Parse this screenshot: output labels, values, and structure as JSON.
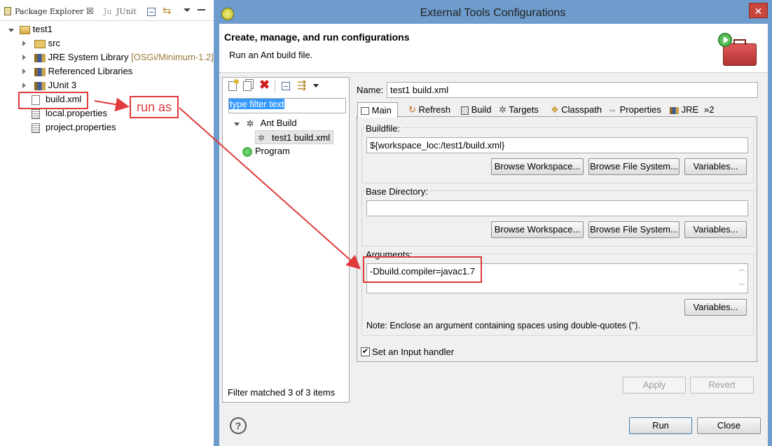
{
  "explorer": {
    "tab_label": "Package Explorer",
    "tab_close": "☒",
    "junit_tab_label": "JUnit",
    "tree": {
      "project": "test1",
      "src": "src",
      "jre": "JRE System Library",
      "jre_decor": "[OSGi/Minimum-1.2]",
      "ref_libs": "Referenced Libraries",
      "junit": "JUnit 3",
      "build_xml": "build.xml",
      "local_props": "local.properties",
      "project_props": "project.properties"
    },
    "callout": "run as"
  },
  "dialog": {
    "title": "External Tools Configurations",
    "close_glyph": "✕",
    "banner": {
      "heading": "Create, manage, and run configurations",
      "subtitle": "Run an Ant build file."
    },
    "filter_placeholder": "type filter text",
    "config_tree": {
      "ant_build": "Ant Build",
      "test1_build": "test1 build.xml",
      "program": "Program"
    },
    "filter_status": "Filter matched 3 of 3 items",
    "name_label": "Name:",
    "name_value": "test1 build.xml",
    "tabs": [
      "Main",
      "Refresh",
      "Build",
      "Targets",
      "Classpath",
      "Properties",
      "JRE",
      "»2"
    ],
    "buildfile": {
      "label": "Buildfile:",
      "value": "${workspace_loc:/test1/build.xml}",
      "browse_workspace": "Browse Workspace...",
      "browse_fs": "Browse File System...",
      "variables": "Variables..."
    },
    "basedir": {
      "label": "Base Directory:",
      "value": "",
      "browse_workspace": "Browse Workspace...",
      "browse_fs": "Browse File System...",
      "variables": "Variables..."
    },
    "arguments": {
      "label": "Arguments:",
      "value": "-Dbuild.compiler=javac1.7",
      "variables": "Variables...",
      "note": "Note: Enclose an argument containing spaces using double-quotes (\")."
    },
    "input_handler": {
      "label": "Set an Input handler",
      "checked": true
    },
    "apply": "Apply",
    "revert": "Revert",
    "run": "Run",
    "close": "Close",
    "help_glyph": "?"
  },
  "colors": {
    "title_bar": "#6e9ccd",
    "dialog_bg": "#f0f0f0",
    "highlight_red": "#e03a3a",
    "selection_blue": "#3399ff"
  }
}
